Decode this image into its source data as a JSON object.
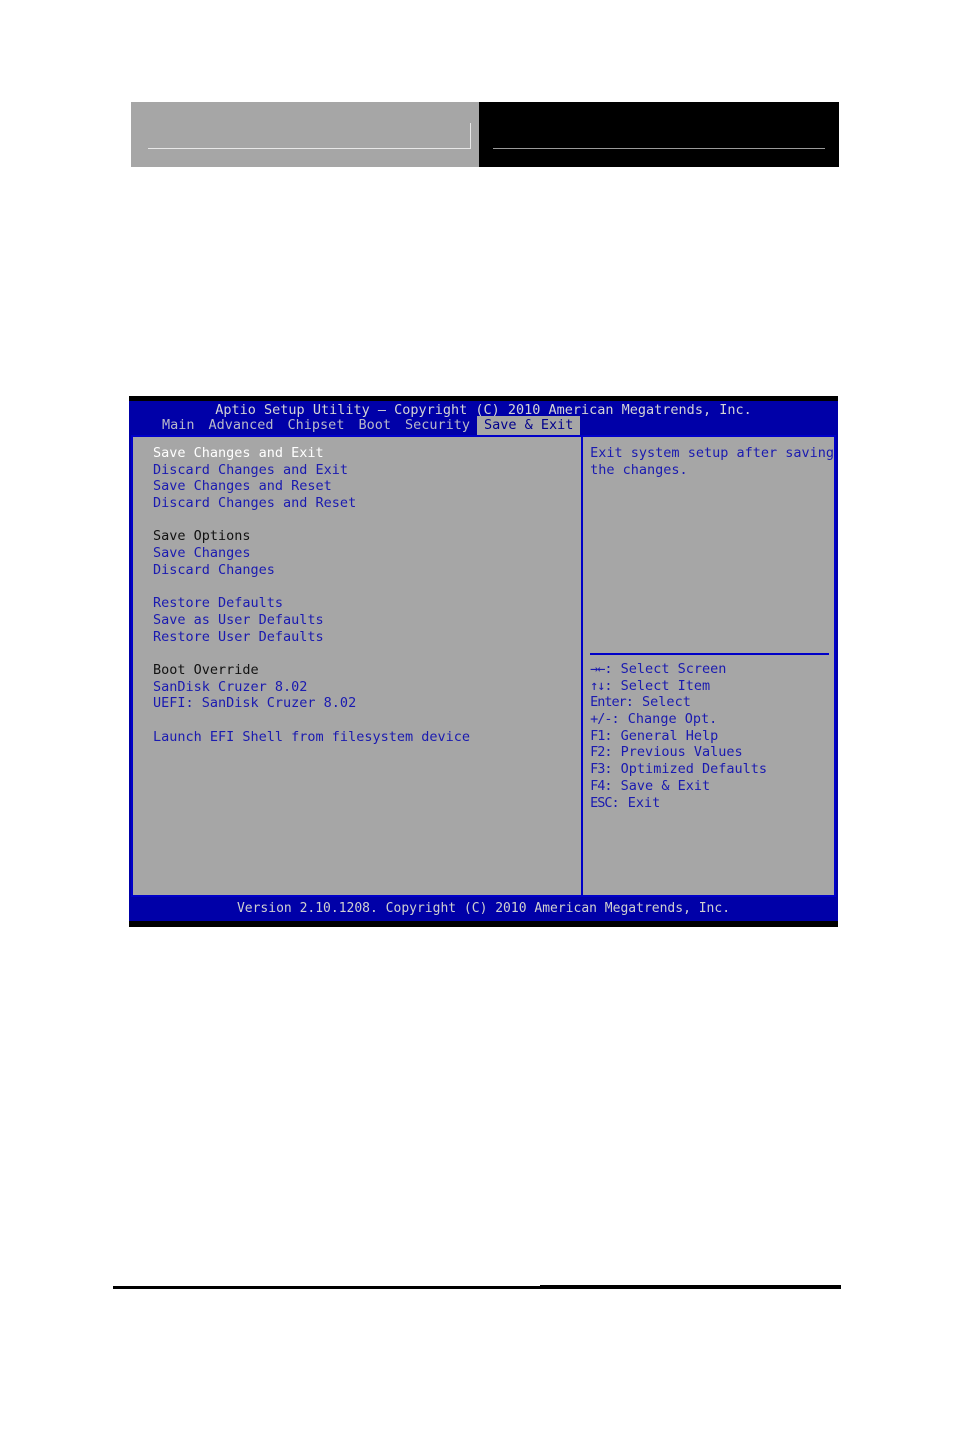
{
  "page": {
    "header": {
      "left_block_label": "",
      "right_block_label": ""
    }
  },
  "bios": {
    "title": "Aptio Setup Utility – Copyright (C) 2010 American Megatrends, Inc.",
    "footer": "Version 2.10.1208. Copyright (C) 2010 American Megatrends, Inc.",
    "tabs": [
      {
        "label": "Main",
        "active": false
      },
      {
        "label": "Advanced",
        "active": false
      },
      {
        "label": "Chipset",
        "active": false
      },
      {
        "label": "Boot",
        "active": false
      },
      {
        "label": "Security",
        "active": false
      },
      {
        "label": "Save & Exit",
        "active": true
      }
    ],
    "menu": [
      {
        "label": "Save Changes and Exit",
        "type": "selected"
      },
      {
        "label": "Discard Changes and Exit",
        "type": "item"
      },
      {
        "label": "Save Changes and Reset",
        "type": "item"
      },
      {
        "label": "Discard Changes and Reset",
        "type": "item"
      },
      {
        "label": " ",
        "type": "spacer"
      },
      {
        "label": "Save Options",
        "type": "heading"
      },
      {
        "label": "Save Changes",
        "type": "item"
      },
      {
        "label": "Discard Changes",
        "type": "item"
      },
      {
        "label": " ",
        "type": "spacer"
      },
      {
        "label": "Restore Defaults",
        "type": "item"
      },
      {
        "label": "Save as User Defaults",
        "type": "item"
      },
      {
        "label": "Restore User Defaults",
        "type": "item"
      },
      {
        "label": " ",
        "type": "spacer"
      },
      {
        "label": "Boot Override",
        "type": "heading"
      },
      {
        "label": "SanDisk Cruzer 8.02",
        "type": "item"
      },
      {
        "label": "UEFI: SanDisk Cruzer 8.02",
        "type": "item"
      },
      {
        "label": " ",
        "type": "spacer"
      },
      {
        "label": "Launch EFI Shell from filesystem device",
        "type": "item"
      }
    ],
    "help": {
      "description": "Exit system setup after saving\nthe changes."
    },
    "keys": [
      {
        "glyph": "→←",
        "label": ": Select Screen"
      },
      {
        "glyph": "↑↓",
        "label": ": Select Item"
      },
      {
        "glyph": "Enter",
        "label": ": Select"
      },
      {
        "glyph": "+/-",
        "label": ": Change Opt."
      },
      {
        "glyph": "F1",
        "label": ": General Help"
      },
      {
        "glyph": "F2",
        "label": ": Previous Values"
      },
      {
        "glyph": "F3",
        "label": ": Optimized Defaults"
      },
      {
        "glyph": "F4",
        "label": ": Save & Exit"
      },
      {
        "glyph": "ESC",
        "label": ": Exit"
      }
    ]
  },
  "colors": {
    "screen_blue": "#0000a8",
    "border_blue": "#0000c8",
    "panel_gray": "#a6a6a6",
    "item_blue": "#1a1ab0",
    "selected_white": "#ffffff",
    "heading_black": "#121212",
    "title_text": "#d4d4d4"
  }
}
